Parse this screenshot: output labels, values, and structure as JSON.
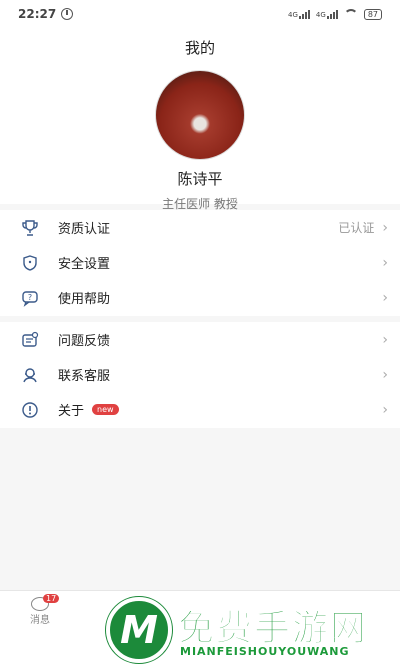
{
  "status_bar": {
    "time": "22:27",
    "battery": "87",
    "network1": "4G",
    "network2": "4G"
  },
  "header": {
    "title": "我的"
  },
  "profile": {
    "name": "陈诗平",
    "title": "主任医师  教授"
  },
  "menu_group_1": [
    {
      "label": "资质认证",
      "status": "已认证",
      "icon": "trophy-icon"
    },
    {
      "label": "安全设置",
      "icon": "shield-icon"
    },
    {
      "label": "使用帮助",
      "icon": "help-bubble-icon"
    }
  ],
  "menu_group_2": [
    {
      "label": "问题反馈",
      "icon": "feedback-icon"
    },
    {
      "label": "联系客服",
      "icon": "headset-icon"
    },
    {
      "label": "关于",
      "badge": "new",
      "icon": "info-icon"
    }
  ],
  "bottom_nav": {
    "messages_label": "消息",
    "messages_count": "17"
  },
  "watermark": {
    "title": "免费手游网",
    "subtitle": "MIANFEISHOUYOUWANG",
    "logo_letter": "M"
  },
  "colors": {
    "accent_red": "#e04141",
    "watermark_green": "#1c9a3a"
  }
}
